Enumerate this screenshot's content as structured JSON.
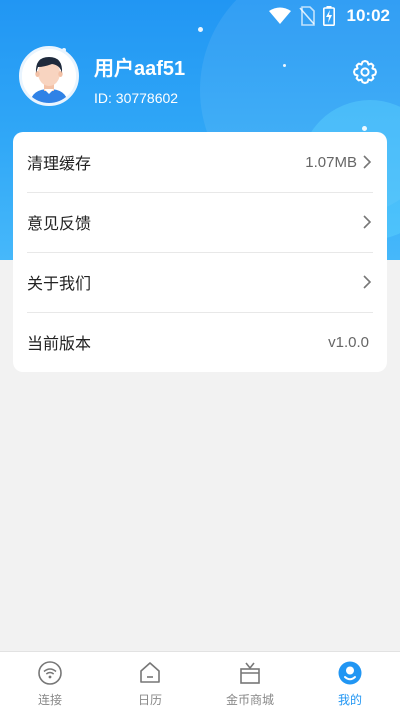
{
  "status_bar": {
    "time": "10:02",
    "icons": [
      "wifi-icon",
      "no-sim-icon",
      "battery-charging-icon"
    ]
  },
  "profile": {
    "username": "用户aaf51",
    "user_id": "ID: 30778602",
    "avatar_icon": "avatar-boy-icon",
    "settings_icon": "gear-icon"
  },
  "menu": {
    "items": [
      {
        "label": "清理缓存",
        "value": "1.07MB",
        "has_arrow": true
      },
      {
        "label": "意见反馈",
        "value": "",
        "has_arrow": true
      },
      {
        "label": "关于我们",
        "value": "",
        "has_arrow": true
      },
      {
        "label": "当前版本",
        "value": "v1.0.0",
        "has_arrow": false
      }
    ]
  },
  "bottom_nav": {
    "items": [
      {
        "label": "连接",
        "icon": "wifi-circle-icon",
        "active": false
      },
      {
        "label": "日历",
        "icon": "home-icon",
        "active": false
      },
      {
        "label": "金币商城",
        "icon": "gift-box-icon",
        "active": false
      },
      {
        "label": "我的",
        "icon": "profile-icon",
        "active": true
      }
    ]
  },
  "colors": {
    "accent": "#2196f3",
    "header_gradient_start": "#2196f3",
    "header_gradient_end": "#46b8fa",
    "background": "#f2f2f2",
    "inactive_nav": "#888888"
  }
}
